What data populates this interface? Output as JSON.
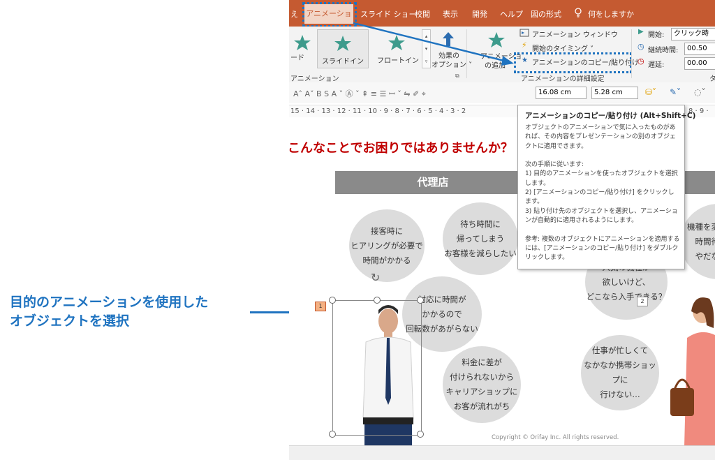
{
  "annotation": {
    "line1": "目的のアニメーションを使用した",
    "line2": "オブジェクトを選択",
    "color": "#1f73c0"
  },
  "ribbon_tabs": {
    "partial": "え",
    "active": "アニメーション",
    "items": [
      "スライド ショー",
      "校閲",
      "表示",
      "開発",
      "ヘルプ",
      "図の形式"
    ],
    "tell_me": "何をしますか"
  },
  "ribbon": {
    "anim_partial": "ード",
    "slide_in": "スライドイン",
    "float_in": "フロートイン",
    "effect_options_1": "効果の",
    "effect_options_2": "オプション ˅",
    "group_animation": "アニメーション",
    "add_anim_1": "アニメーショ",
    "add_anim_2": "の追加",
    "animation_window": "アニメーション ウィンドウ",
    "trigger": "開始のタイミング ˅",
    "copy_paste": "アニメーションのコピー/貼り付け",
    "group_advanced": "アニメーションの詳細設定",
    "start_label": "開始:",
    "start_value": "クリック時",
    "duration_label": "継続時間:",
    "duration_value": "00.50",
    "delay_label": "遅延:",
    "delay_value": "00.00",
    "group_timing_partial": "タ"
  },
  "format_bar": {
    "height_value": "16.08 cm",
    "width_value": "5.28 cm"
  },
  "ruler": "15 · 14 · 13 · 12 · 11 · 10 · 9 · 8 · 7 · 6 · 5 · 4 · 3 · 2",
  "ruler_right": "8 · 9 ·",
  "tooltip": {
    "title": "アニメーションのコピー/貼り付け (Alt+Shift+C)",
    "body": "オブジェクトのアニメーションで気に入ったものがあれば、その内容をプレゼンテーションの別のオブジェクトに適用できます。\n\n次の手順に従います:\n1) 目的のアニメーションを使ったオブジェクトを選択します。\n2) [アニメーションのコピー/貼り付け] をクリックします。\n3) 貼り付け先のオブジェクトを選択し、アニメーションが自動的に適用されるようにします。\n\n参考: 複数のオブジェクトにアニメーションを適用するには、[アニメーションのコピー/貼り付け] をダブルクリックします。"
  },
  "slide": {
    "heading": "こんなことでお困りではありませんか？",
    "banner": "代理店",
    "bubbles": [
      "接客時に\nヒアリングが必要で\n時間がかかる",
      "待ち時間に\n帰ってしまう\nお客様を減らしたい",
      "対応に時間が\nかかるので\n回転数があがらない",
      "料金に差が\n付けられないから\nキャリアショップに\nお客が流れがち",
      "人気の機種が\n欲しいけど、\nどこなら入手できる？",
      "仕事が忙しくて\nなかなか携帯ショップに\n行けない…",
      "機種を変えた\n時間待つ\nやだな一"
    ],
    "badge_1": "1",
    "badge_2": "2",
    "copyright": "Copyright © Orifay Inc. All rights reserved."
  }
}
